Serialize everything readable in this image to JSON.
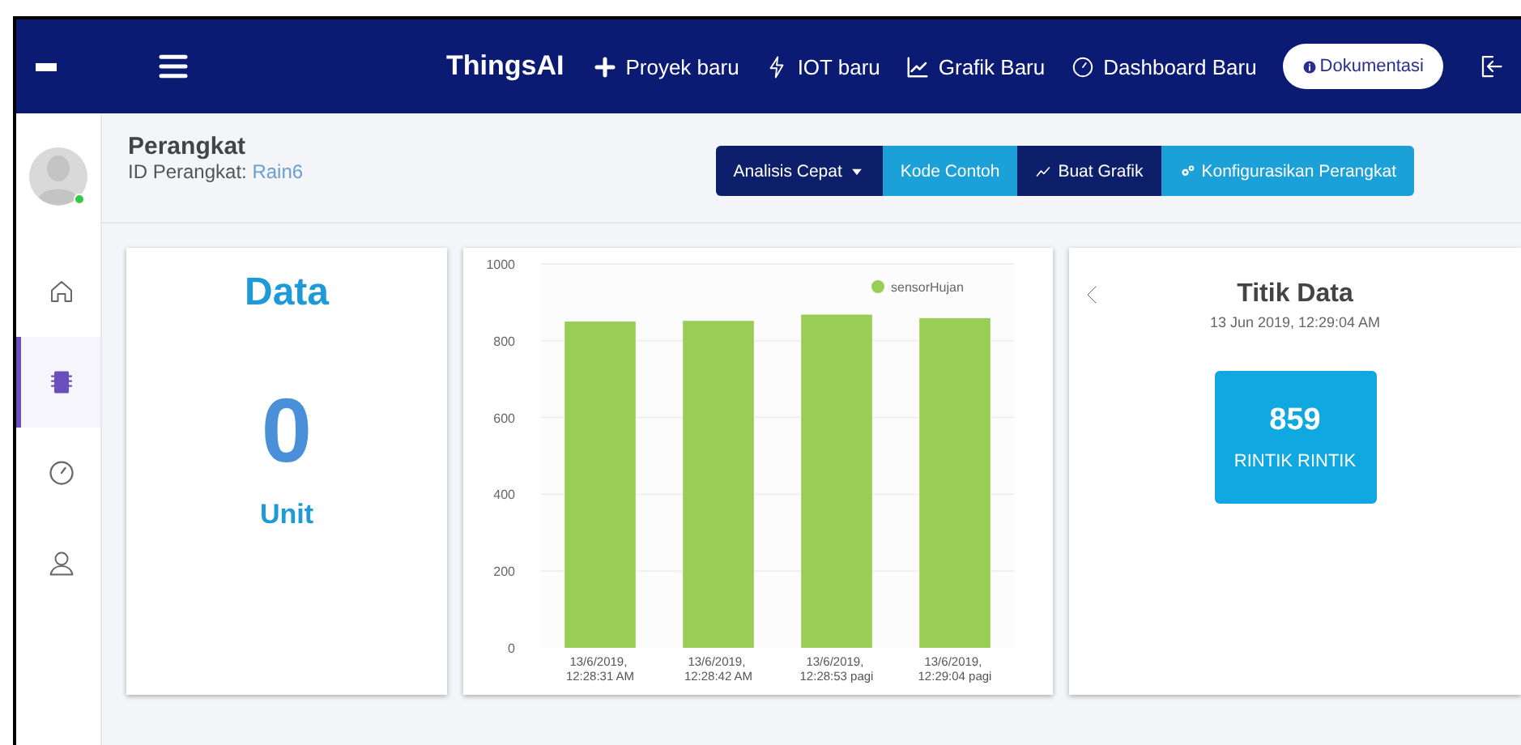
{
  "topbar": {
    "brand": "ThingsAI",
    "nav": [
      {
        "label": "Proyek baru"
      },
      {
        "label": "IOT baru"
      },
      {
        "label": "Grafik Baru"
      },
      {
        "label": "Dashboard Baru"
      }
    ],
    "doc_button": {
      "label": "Dokumentasi"
    }
  },
  "sidebar": {
    "user": {
      "online": true
    },
    "items": [
      {
        "selected": false
      },
      {
        "selected": true
      },
      {
        "selected": false
      },
      {
        "selected": false
      }
    ]
  },
  "header": {
    "title": "Perangkat",
    "id_label": "ID Perangkat:",
    "id_value": "Rain6",
    "actions": [
      {
        "label": "Analisis Cepat"
      },
      {
        "label": "Kode Contoh"
      },
      {
        "label": "Buat Grafik"
      },
      {
        "label": "Konfigurasikan Perangkat"
      }
    ]
  },
  "data_card": {
    "title": "Data",
    "value": "0",
    "unit": "Unit"
  },
  "chart_card": {
    "chart_data": {
      "type": "bar",
      "categories": [
        "13/6/2019, 12:28:31 AM",
        "13/6/2019, 12:28:42 AM",
        "13/6/2019, 12:28:53 pagi",
        "13/6/2019, 12:29:04 pagi"
      ],
      "series": [
        {
          "name": "sensorHujan",
          "color": "#9acd55",
          "values": [
            850,
            852,
            868,
            859
          ]
        }
      ],
      "grid": true,
      "ylim": [
        0,
        1000
      ],
      "yticks": [
        0,
        200,
        400,
        600,
        800,
        1000
      ]
    }
  },
  "point_card": {
    "title": "Titik Data",
    "timestamp": "13 Jun 2019, 12:29:04 AM",
    "value": "859",
    "label": "RINTIK RINTIK"
  }
}
